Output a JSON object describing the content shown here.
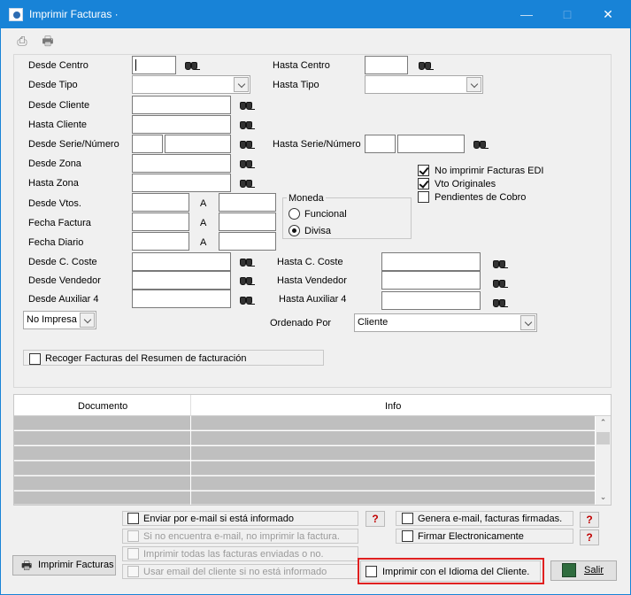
{
  "window": {
    "title": "Imprimir Facturas ·",
    "minimize": "—",
    "maximize": "□",
    "close": "✕"
  },
  "toolbar": {
    "preview_icon": "preview-icon",
    "print_icon": "printer-icon"
  },
  "filters": {
    "desde_centro": "Desde Centro",
    "hasta_centro": "Hasta Centro",
    "desde_tipo": "Desde Tipo",
    "hasta_tipo": "Hasta Tipo",
    "desde_cliente": "Desde Cliente",
    "hasta_cliente": "Hasta Cliente",
    "desde_serie": "Desde Serie/Número",
    "hasta_serie": "Hasta Serie/Número",
    "desde_zona": "Desde Zona",
    "hasta_zona": "Hasta Zona",
    "desde_vtos": "Desde Vtos.",
    "fecha_factura": "Fecha Factura",
    "fecha_diario": "Fecha Diario",
    "a": "A",
    "desde_coste": "Desde C. Coste",
    "hasta_coste": "Hasta C. Coste",
    "desde_vendedor": "Desde Vendedor",
    "hasta_vendedor": "Hasta Vendedor",
    "desde_auxiliar": "Desde Auxiliar 4",
    "hasta_auxiliar": "Hasta Auxiliar 4",
    "impresa_value": "No Impresa",
    "ordenado_por": "Ordenado Por",
    "ordenado_value": "Cliente"
  },
  "moneda": {
    "title": "Moneda",
    "funcional": "Funcional",
    "divisa": "Divisa"
  },
  "options": {
    "no_edi": "No imprimir Facturas EDI",
    "vto_originales": "Vto Originales",
    "pendientes": "Pendientes de Cobro"
  },
  "recoger": "Recoger Facturas del Resumen de facturación",
  "grid": {
    "col_documento": "Documento",
    "col_info": "Info"
  },
  "bottom": {
    "enviar_email": "Enviar por e-mail si está informado",
    "si_no_email": "Si no encuentra e-mail, no imprimir la factura.",
    "imprimir_todas": "Imprimir todas las facturas enviadas o no.",
    "usar_email": "Usar email del cliente si no está informado",
    "genera_email": "Genera e-mail, facturas firmadas.",
    "firmar": "Firmar Electronicamente",
    "idioma": "Imprimir con el Idioma del Cliente.",
    "imprimir_facturas": "Imprimir Facturas",
    "salir": "Salir",
    "help": "?"
  },
  "colors": {
    "titlebar": "#1883d7",
    "highlight": "#e02020",
    "grid_row": "#bfbfbf"
  }
}
